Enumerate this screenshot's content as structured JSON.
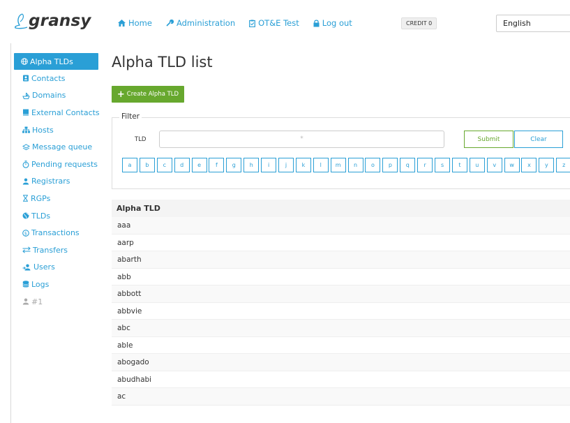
{
  "brand": {
    "logo_text": "gransy"
  },
  "topnav": {
    "home": "Home",
    "administration": "Administration",
    "ote_test": "OT&E Test",
    "logout": "Log out"
  },
  "credit": "CREDIT 0",
  "language": "English",
  "sidebar": {
    "items": [
      {
        "label": "Alpha TLDs",
        "icon": "globe-icon"
      },
      {
        "label": "Contacts",
        "icon": "contacts-icon"
      },
      {
        "label": "Domains",
        "icon": "domains-icon"
      },
      {
        "label": "External Contacts",
        "icon": "book-icon"
      },
      {
        "label": "Hosts",
        "icon": "sitemap-icon"
      },
      {
        "label": "Message queue",
        "icon": "layers-icon"
      },
      {
        "label": "Pending requests",
        "icon": "stopwatch-icon"
      },
      {
        "label": "Registrars",
        "icon": "registrars-icon"
      },
      {
        "label": "RGPs",
        "icon": "hourglass-icon"
      },
      {
        "label": "TLDs",
        "icon": "globe-solid-icon"
      },
      {
        "label": "Transactions",
        "icon": "coin-icon"
      },
      {
        "label": "Transfers",
        "icon": "transfer-icon"
      },
      {
        "label": "Users",
        "icon": "users-icon"
      },
      {
        "label": "Logs",
        "icon": "database-icon"
      },
      {
        "label": "#1",
        "icon": "user-icon"
      }
    ]
  },
  "page": {
    "title": "Alpha TLD list",
    "create_button": "Create Alpha TLD"
  },
  "filter": {
    "legend": "Filter",
    "tld_label": "TLD",
    "tld_value": "*",
    "submit": "Submit",
    "clear": "Clear",
    "letters": [
      "a",
      "b",
      "c",
      "d",
      "e",
      "f",
      "g",
      "h",
      "i",
      "j",
      "k",
      "l",
      "m",
      "n",
      "o",
      "p",
      "q",
      "r",
      "s",
      "t",
      "u",
      "v",
      "w",
      "x",
      "y",
      "z"
    ]
  },
  "table": {
    "header": "Alpha TLD",
    "rows": [
      "aaa",
      "aarp",
      "abarth",
      "abb",
      "abbott",
      "abbvie",
      "abc",
      "able",
      "abogado",
      "abudhabi",
      "ac"
    ]
  },
  "colors": {
    "accent": "#2a9fd6",
    "success": "#67a82e",
    "text": "#333333"
  }
}
